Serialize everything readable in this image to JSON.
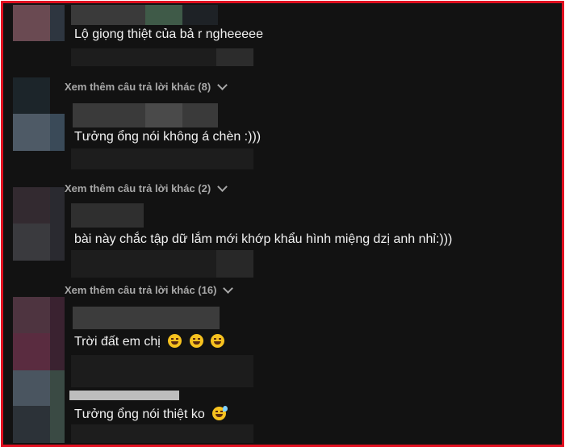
{
  "comments": [
    {
      "text": "Lộ giọng thiệt của bả r ngheeeee",
      "emojis": []
    },
    {
      "text": "Tưởng ổng nói không á chèn :)))",
      "emojis": []
    },
    {
      "text": "bài này chắc tập dữ lắm mới khớp khẩu hình miệng dzị anh nhỉ:)))",
      "emojis": []
    },
    {
      "text": "Trời đất em chị",
      "emojis": [
        "laughing-tears-emoji",
        "laughing-tears-emoji",
        "laughing-tears-emoji"
      ]
    },
    {
      "text": "Tưởng ổng nói thiệt ko",
      "emojis": [
        "sweat-smile-emoji"
      ]
    }
  ],
  "replies": [
    {
      "label": "Xem thêm câu trả lời khác (8)"
    },
    {
      "label": "Xem thêm câu trả lời khác (2)"
    },
    {
      "label": "Xem thêm câu trả lời khác (16)"
    }
  ],
  "colors": {
    "border": "#e01020",
    "background": "#121212",
    "text": "#f2f2f2",
    "muted": "#a8a8a8"
  }
}
